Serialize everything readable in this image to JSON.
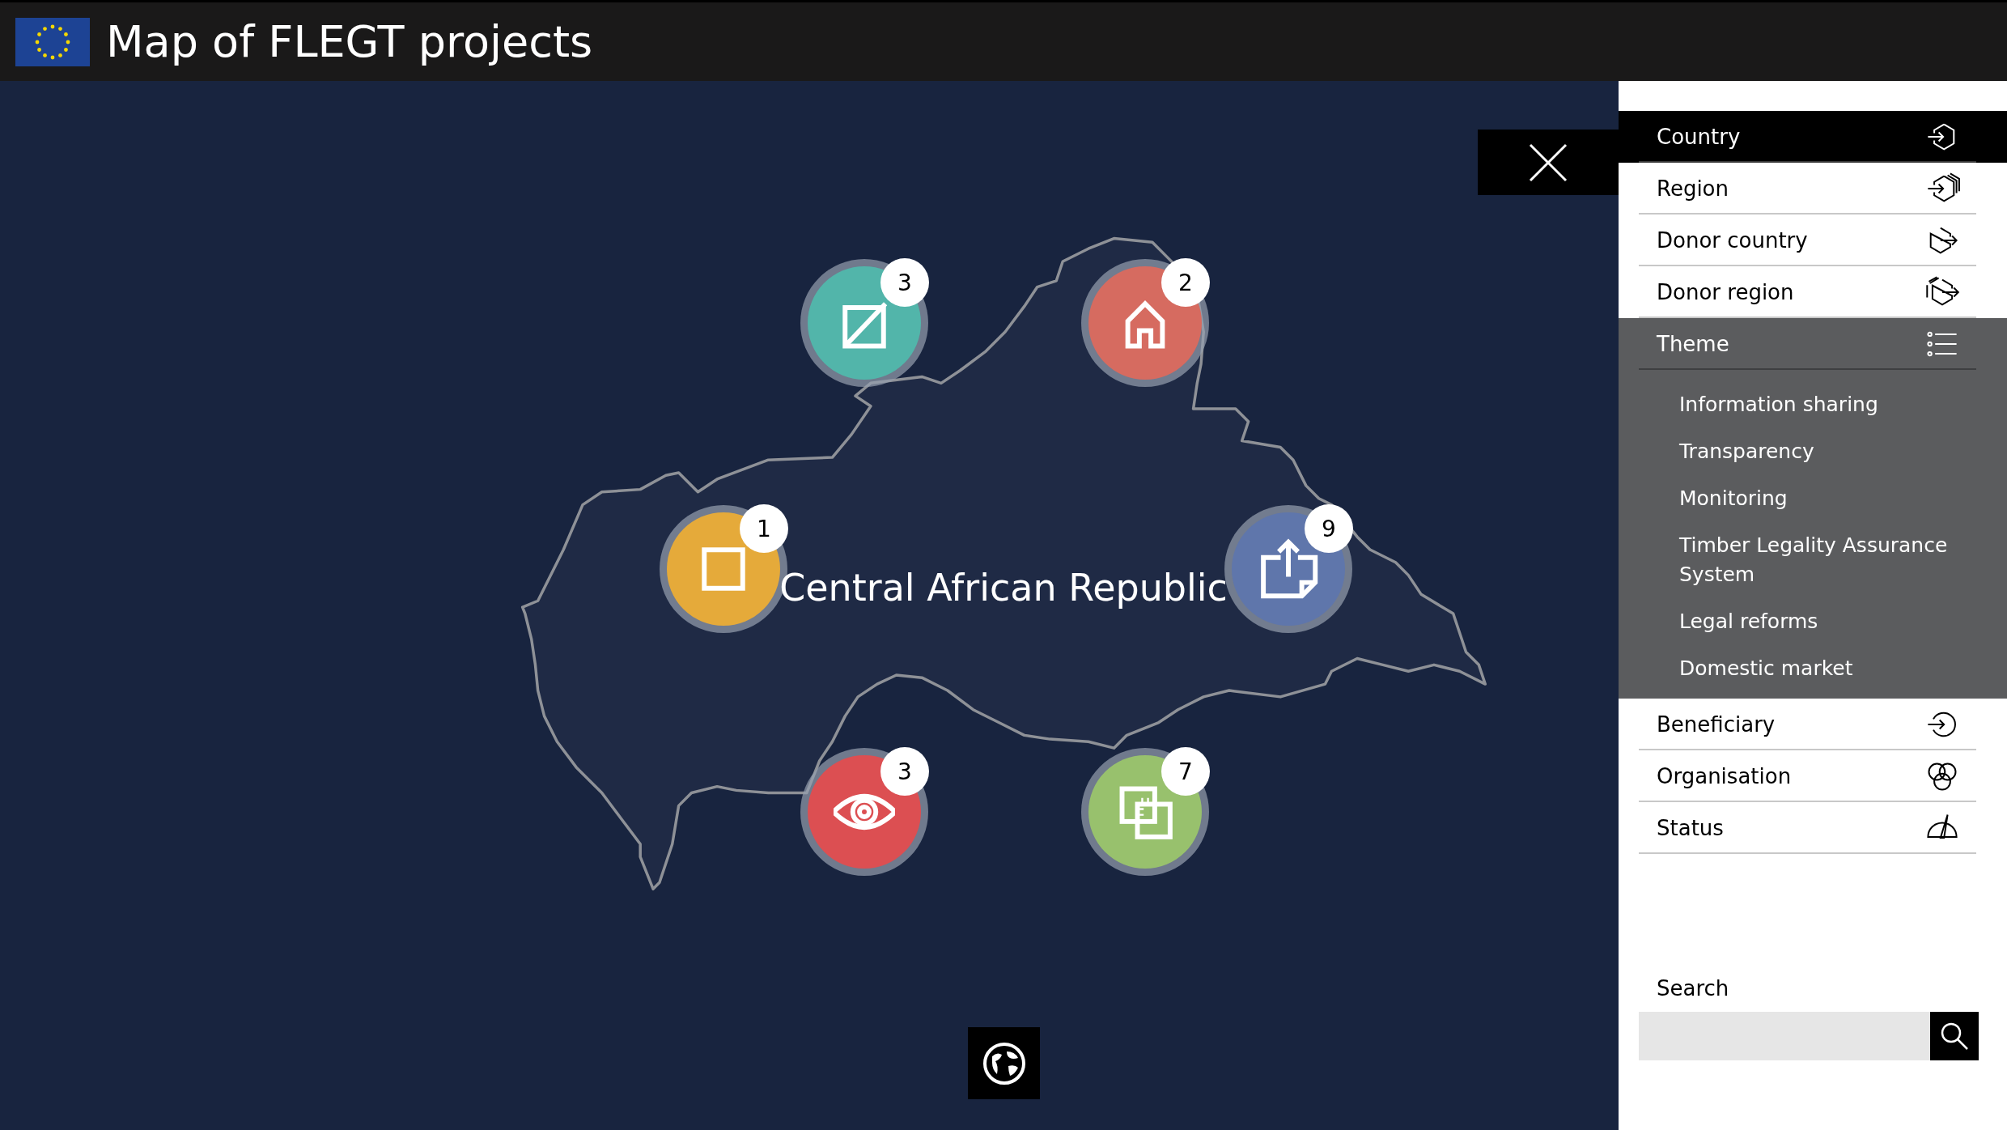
{
  "header": {
    "title": "Map of FLEGT projects"
  },
  "map": {
    "country_label": "Central African Republic",
    "markers": [
      {
        "kind": "diagonal",
        "color": "#52b5aa",
        "count": "3"
      },
      {
        "kind": "house",
        "color": "#d66b60",
        "count": "2"
      },
      {
        "kind": "square",
        "color": "#e5aa3a",
        "count": "1"
      },
      {
        "kind": "upload",
        "color": "#5f76ab",
        "count": "9"
      },
      {
        "kind": "eye",
        "color": "#dc4f52",
        "count": "3"
      },
      {
        "kind": "overlap",
        "color": "#98c16d",
        "count": "7"
      }
    ]
  },
  "filters": [
    {
      "kind": "country",
      "label": "Country",
      "selected": true
    },
    {
      "kind": "region",
      "label": "Region",
      "selected": false
    },
    {
      "kind": "donorcountry",
      "label": "Donor country",
      "selected": false
    },
    {
      "kind": "donorregion",
      "label": "Donor region",
      "selected": false
    },
    {
      "kind": "list",
      "label": "Theme",
      "selected": false,
      "expanded": true,
      "children": [
        {
          "label": "Information sharing"
        },
        {
          "label": "Transparency"
        },
        {
          "label": "Monitoring"
        },
        {
          "label": "Timber Legality Assurance System"
        },
        {
          "label": "Legal reforms"
        },
        {
          "label": "Domestic market"
        }
      ]
    },
    {
      "kind": "beneficiary",
      "label": "Beneficiary",
      "selected": false
    },
    {
      "kind": "organisation",
      "label": "Organisation",
      "selected": false
    },
    {
      "kind": "status",
      "label": "Status",
      "selected": false
    }
  ],
  "search": {
    "label": "Search"
  }
}
